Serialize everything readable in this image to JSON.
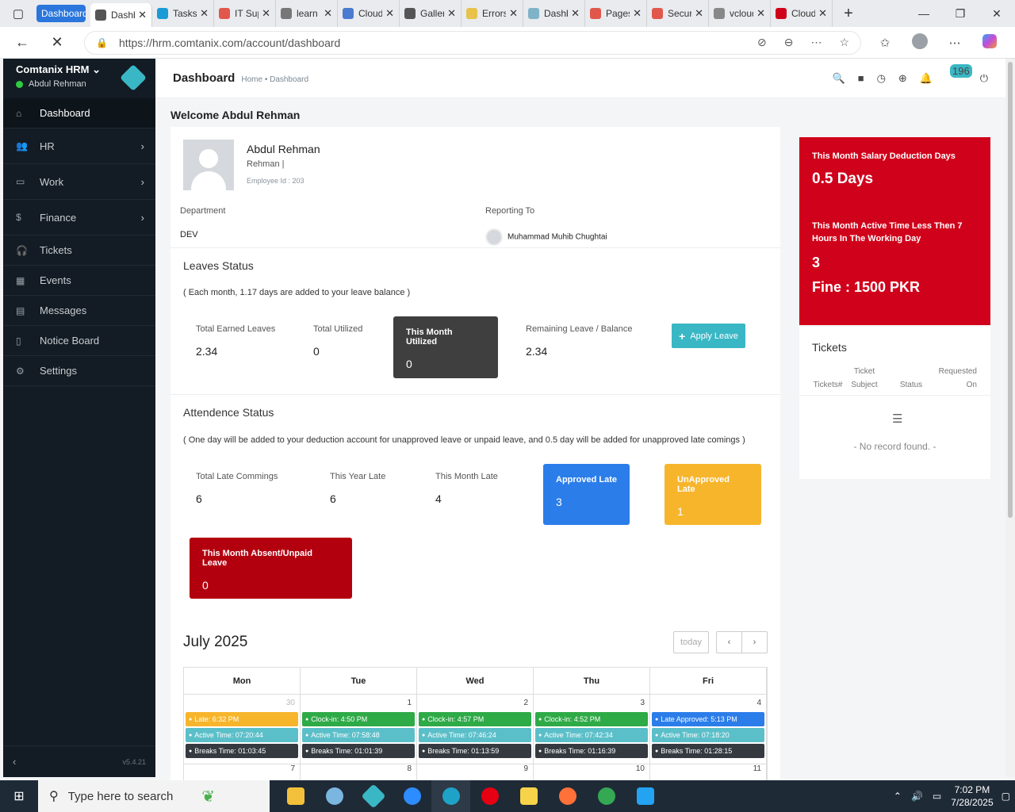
{
  "browser": {
    "tab_group": "Dashboard",
    "tabs": [
      {
        "label": "Dashboard",
        "color": "#555555",
        "active": true
      },
      {
        "label": "Tasks",
        "color": "#1a9bd7"
      },
      {
        "label": "IT Support",
        "color": "#e2574c"
      },
      {
        "label": "learn",
        "color": "#777777"
      },
      {
        "label": "Cloud",
        "color": "#4a7bd0"
      },
      {
        "label": "Gallery",
        "color": "#555555"
      },
      {
        "label": "Errors",
        "color": "#e8c24a"
      },
      {
        "label": "Dashboard",
        "color": "#7fb3c8"
      },
      {
        "label": "Pages",
        "color": "#e2574c"
      },
      {
        "label": "Security",
        "color": "#e2574c"
      },
      {
        "label": "vcloud",
        "color": "#888888"
      },
      {
        "label": "Cloud M",
        "color": "#d0021b"
      }
    ],
    "url": "https://hrm.comtanix.com/account/dashboard"
  },
  "sidebar": {
    "brand": "Comtanix HRM",
    "user": "Abdul Rehman",
    "items": [
      {
        "label": "Dashboard",
        "icon": "⌂",
        "chevron": false,
        "active": true
      },
      {
        "label": "HR",
        "icon": "👥",
        "chevron": true
      },
      {
        "label": "Work",
        "icon": "▭",
        "chevron": true
      },
      {
        "label": "Finance",
        "icon": "$",
        "chevron": true
      },
      {
        "label": "Tickets",
        "icon": "🎧",
        "chevron": false
      },
      {
        "label": "Events",
        "icon": "▦",
        "chevron": false
      },
      {
        "label": "Messages",
        "icon": "▤",
        "chevron": false
      },
      {
        "label": "Notice Board",
        "icon": "▯",
        "chevron": false
      },
      {
        "label": "Settings",
        "icon": "⚙",
        "chevron": false
      }
    ],
    "version": "v5.4.21"
  },
  "header": {
    "title": "Dashboard",
    "breadcrumb": "Home • Dashboard",
    "notification_count": "196"
  },
  "welcome": "Welcome Abdul Rehman",
  "profile": {
    "name": "Abdul Rehman",
    "subtitle": "Rehman |",
    "employee_id": "Employee Id : 203",
    "department_label": "Department",
    "department_value": "DEV",
    "reporting_label": "Reporting To",
    "reporting_value": "Muhammad Muhib Chughtai"
  },
  "leaves": {
    "title": "Leaves Status",
    "note": "( Each month, 1.17 days are added to your leave balance )",
    "earned_label": "Total Earned Leaves",
    "earned_value": "2.34",
    "utilized_label": "Total Utilized",
    "utilized_value": "0",
    "month_utilized_label": "This Month Utilized",
    "month_utilized_value": "0",
    "remaining_label": "Remaining Leave / Balance",
    "remaining_value": "2.34",
    "apply_label": "Apply Leave"
  },
  "attendance": {
    "title": "Attendence Status",
    "note": "( One day will be added to your deduction account for unapproved leave or unpaid leave, and 0.5 day will be added for unapproved late comings )",
    "total_late_label": "Total Late Commings",
    "total_late_value": "6",
    "year_late_label": "This Year Late",
    "year_late_value": "6",
    "month_late_label": "This Month Late",
    "month_late_value": "4",
    "approved_label": "Approved Late",
    "approved_value": "3",
    "unapproved_label": "UnApproved Late",
    "unapproved_value": "1",
    "absent_label": "This Month Absent/Unpaid Leave",
    "absent_value": "0"
  },
  "calendar": {
    "title": "July 2025",
    "today_label": "today",
    "days": [
      "Mon",
      "Tue",
      "Wed",
      "Thu",
      "Fri"
    ],
    "week1": [
      {
        "date": "30",
        "muted": true,
        "events": [
          {
            "text": "Late: 6:32 PM",
            "color": "#f7b52c"
          },
          {
            "text": "Active Time: 07:20:44",
            "color": "#5bbfc9"
          },
          {
            "text": "Breaks Time: 01:03:45",
            "color": "#343a40"
          }
        ]
      },
      {
        "date": "1",
        "events": [
          {
            "text": "Clock-in: 4:50 PM",
            "color": "#2eaa47"
          },
          {
            "text": "Active Time: 07:58:48",
            "color": "#5bbfc9"
          },
          {
            "text": "Breaks Time: 01:01:39",
            "color": "#343a40"
          }
        ]
      },
      {
        "date": "2",
        "events": [
          {
            "text": "Clock-in: 4:57 PM",
            "color": "#2eaa47"
          },
          {
            "text": "Active Time: 07:46:24",
            "color": "#5bbfc9"
          },
          {
            "text": "Breaks Time: 01:13:59",
            "color": "#343a40"
          }
        ]
      },
      {
        "date": "3",
        "events": [
          {
            "text": "Clock-in: 4:52 PM",
            "color": "#2eaa47"
          },
          {
            "text": "Active Time: 07:42:34",
            "color": "#5bbfc9"
          },
          {
            "text": "Breaks Time: 01:16:39",
            "color": "#343a40"
          }
        ]
      },
      {
        "date": "4",
        "events": [
          {
            "text": "Late Approved: 5:13 PM",
            "color": "#2b7de9"
          },
          {
            "text": "Active Time: 07:18:20",
            "color": "#5bbfc9"
          },
          {
            "text": "Breaks Time: 01:28:15",
            "color": "#343a40"
          }
        ]
      }
    ],
    "week2_dates": [
      "7",
      "8",
      "9",
      "10",
      "11"
    ]
  },
  "salary": {
    "deduction_label": "This Month Salary Deduction Days",
    "deduction_value": "0.5 Days",
    "active_label": "This Month Active Time Less Then 7 Hours In The Working Day",
    "active_value": "3",
    "fine": "Fine : 1500 PKR"
  },
  "tickets": {
    "title": "Tickets",
    "col1": "Tickets#",
    "col2": "Ticket Subject",
    "col3": "Status",
    "col4": "Requested On",
    "empty": "- No record found. -"
  },
  "taskbar": {
    "search_placeholder": "Type here to search",
    "time": "7:02 PM",
    "date": "7/28/2025"
  },
  "colors": {
    "accent": "#3ab7c4",
    "danger": "#d0021b",
    "approved": "#2b7de9",
    "unapproved": "#f7b52c",
    "dark_box": "#3f3f3f"
  }
}
